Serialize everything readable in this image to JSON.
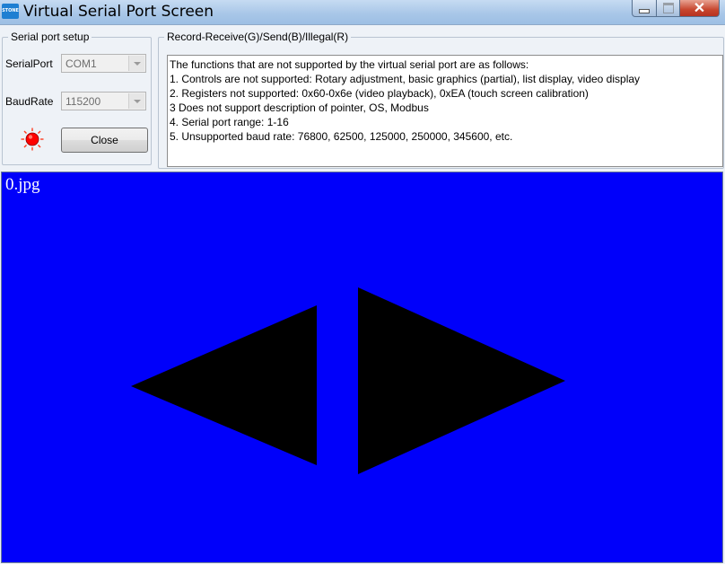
{
  "window": {
    "logo_text": "STONE",
    "title": "Virtual Serial Port Screen",
    "close_glyph": "✕"
  },
  "setup": {
    "group_label": "Serial port setup",
    "serial_port_label": "SerialPort",
    "serial_port_value": "COM1",
    "baud_rate_label": "BaudRate",
    "baud_rate_value": "115200",
    "status_led_color": "#ff0000",
    "close_button_label": "Close"
  },
  "record": {
    "group_label": "Record-Receive(G)/Send(B)/Illegal(R)",
    "lines": [
      "The functions that are not supported by the virtual serial port are as follows:",
      "1. Controls are not supported: Rotary adjustment, basic graphics (partial), list display, video display",
      "2. Registers not supported: 0x60-0x6e (video playback), 0xEA (touch screen calibration)",
      "3 Does not support description of pointer, OS, Modbus",
      "4. Serial port range: 1-16",
      "5. Unsupported baud rate: 76800, 62500, 125000, 250000, 345600, etc."
    ]
  },
  "screen": {
    "image_name": "0.jpg",
    "background_color": "#0000fa",
    "shape_color": "#000000",
    "shapes": [
      "left-arrow-triangle",
      "right-arrow-triangle"
    ]
  }
}
